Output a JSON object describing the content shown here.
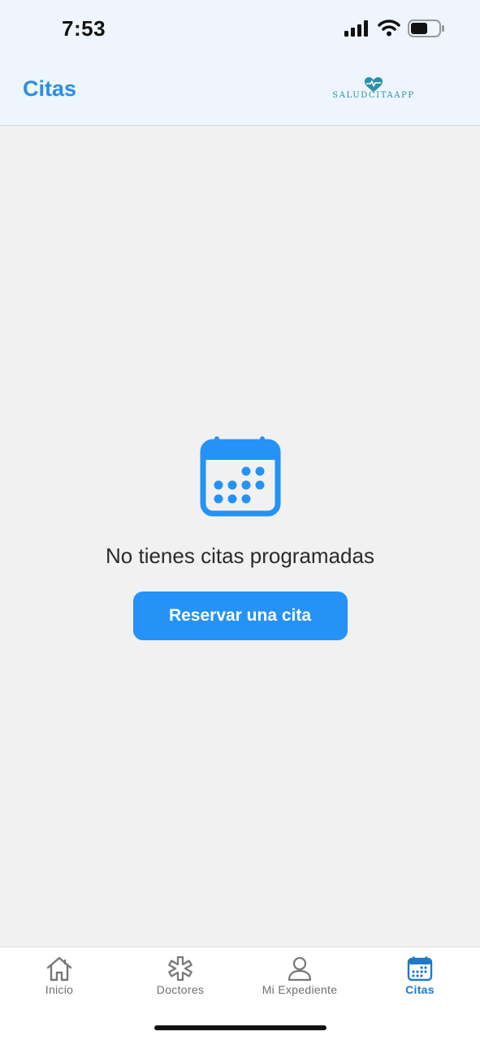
{
  "status_bar": {
    "time": "7:53",
    "icons": [
      "signal-icon",
      "wifi-icon",
      "battery-icon"
    ]
  },
  "header": {
    "title": "Citas",
    "logo_text": "SALUDCITAAPP",
    "logo_icon": "heart-pulse-icon"
  },
  "empty_state": {
    "icon": "calendar-icon",
    "message": "No tienes citas programadas",
    "button_label": "Reservar una cita"
  },
  "tab_bar": {
    "tabs": [
      {
        "label": "Inicio",
        "icon": "home-icon",
        "active": false
      },
      {
        "label": "Doctores",
        "icon": "medical-star-icon",
        "active": false
      },
      {
        "label": "Mi Expediente",
        "icon": "person-icon",
        "active": false
      },
      {
        "label": "Citas",
        "icon": "calendar-icon",
        "active": true
      }
    ]
  },
  "colors": {
    "accent": "#2492f7",
    "title": "#2a8ee6",
    "active_tab": "#1f78c8",
    "header_bg": "#eef5fd",
    "content_bg": "#f1f1f1"
  }
}
